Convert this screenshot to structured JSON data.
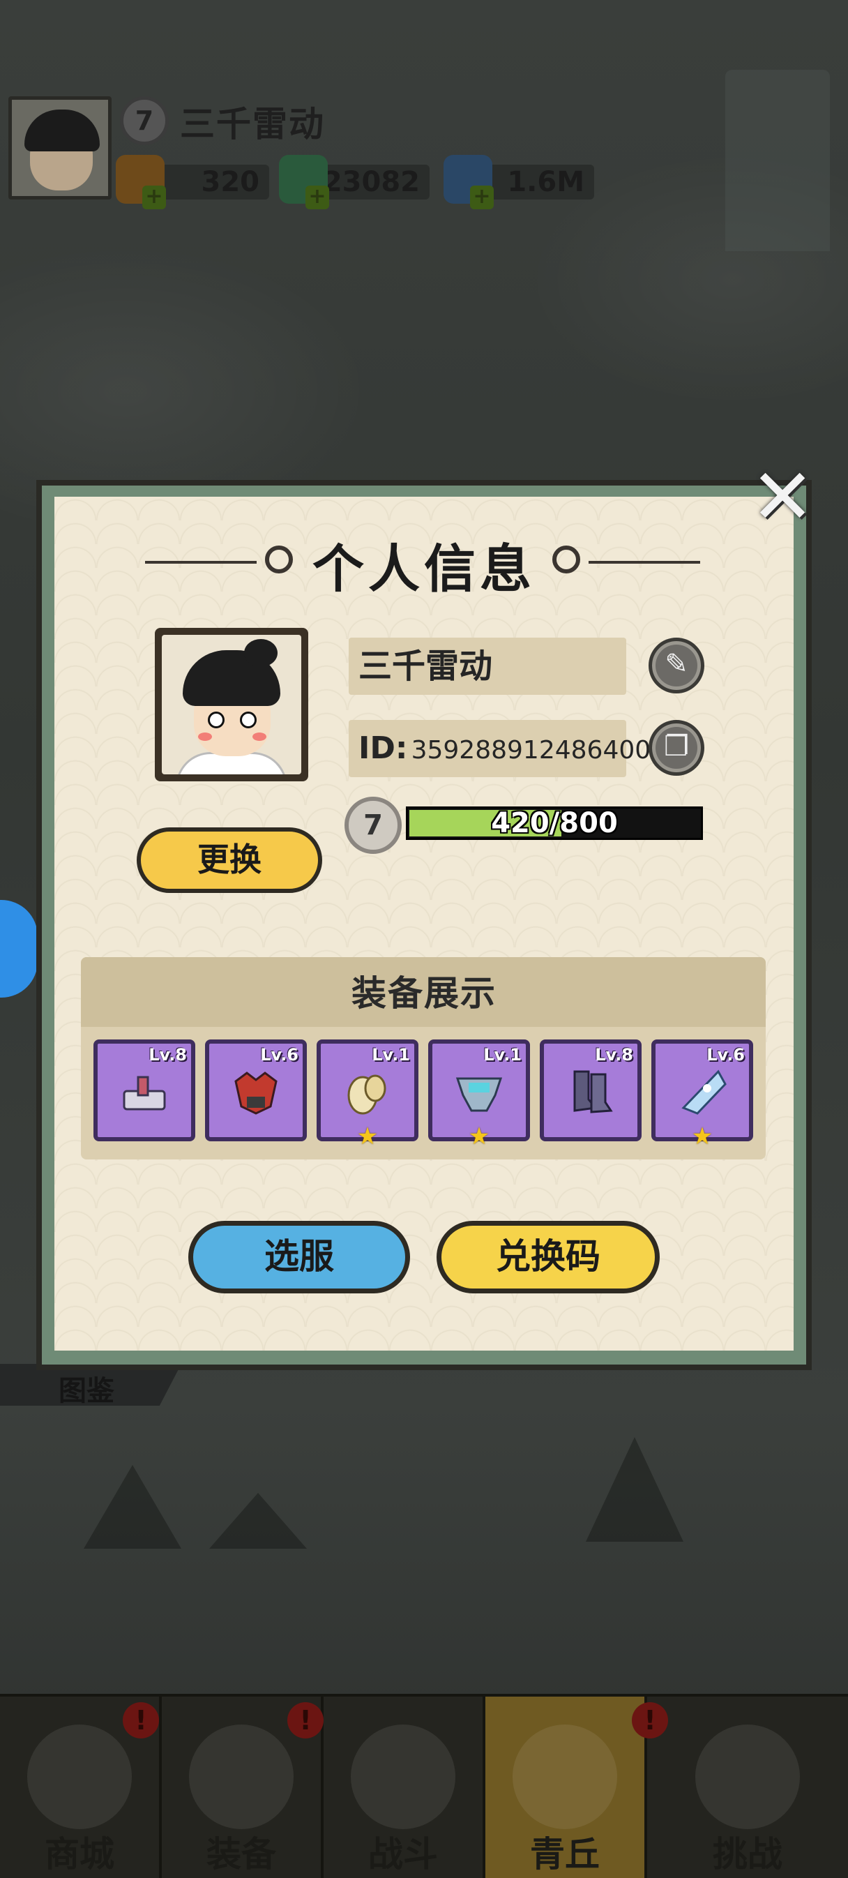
{
  "player": {
    "name": "三千雷动",
    "level": "7",
    "id_label": "ID:",
    "id_value": "359288912486400",
    "xp_text": "420/800",
    "xp_fraction": 0.525
  },
  "resources": [
    {
      "icon": "treasure-icon",
      "value": "320",
      "color": "#8a5a1e"
    },
    {
      "icon": "jade-dragon-icon",
      "value": "23082",
      "color": "#2f6b46"
    },
    {
      "icon": "crystal-icon",
      "value": "1.6M",
      "color": "#2c4f73"
    }
  ],
  "modal": {
    "title": "个人信息",
    "swap_label": "更换",
    "equip_title": "装备展示",
    "server_label": "选服",
    "code_label": "兑换码",
    "close_glyph": "✕"
  },
  "equipment": [
    {
      "level": "Lv.8",
      "icon": "anvil-icon",
      "star": false
    },
    {
      "level": "Lv.6",
      "icon": "demon-mask-icon",
      "star": false
    },
    {
      "level": "Lv.1",
      "icon": "gold-shoulder-icon",
      "star": true
    },
    {
      "level": "Lv.1",
      "icon": "frost-armor-icon",
      "star": true
    },
    {
      "level": "Lv.8",
      "icon": "boots-icon",
      "star": false
    },
    {
      "level": "Lv.6",
      "icon": "ice-crystal-icon",
      "star": true
    }
  ],
  "background": {
    "tujian_label": "图鉴"
  },
  "nav": [
    {
      "label": "商城",
      "icon": "shop-icon",
      "badge": "!",
      "active": false
    },
    {
      "label": "装备",
      "icon": "helmet-icon",
      "badge": "!",
      "active": false
    },
    {
      "label": "战斗",
      "icon": "crossed-swords-icon",
      "badge": "",
      "active": false
    },
    {
      "label": "青丘",
      "icon": "mountain-icon",
      "badge": "!",
      "active": true
    },
    {
      "label": "挑战",
      "icon": "challenge-icon",
      "badge": "",
      "active": false
    }
  ],
  "colors": {
    "modal_border": "#6f8b76",
    "parchment": "#f1e9d6",
    "slot_purple": "#a67cd9",
    "xp_green": "#a6d55a",
    "button_yellow": "#f6c94a",
    "button_blue": "#56b1e2"
  }
}
